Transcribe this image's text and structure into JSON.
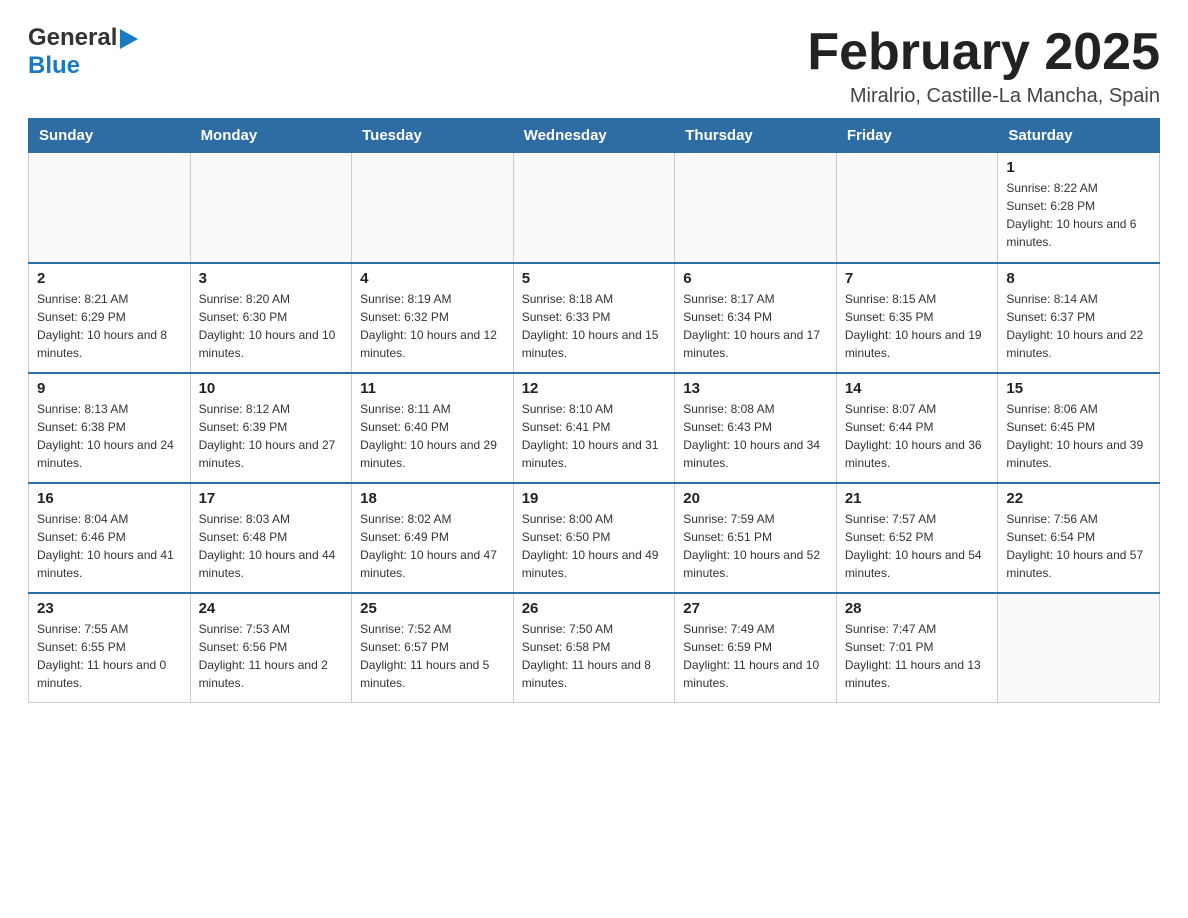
{
  "logo": {
    "general": "General",
    "blue": "Blue"
  },
  "title": "February 2025",
  "subtitle": "Miralrio, Castille-La Mancha, Spain",
  "weekdays": [
    "Sunday",
    "Monday",
    "Tuesday",
    "Wednesday",
    "Thursday",
    "Friday",
    "Saturday"
  ],
  "weeks": [
    [
      {
        "day": "",
        "info": ""
      },
      {
        "day": "",
        "info": ""
      },
      {
        "day": "",
        "info": ""
      },
      {
        "day": "",
        "info": ""
      },
      {
        "day": "",
        "info": ""
      },
      {
        "day": "",
        "info": ""
      },
      {
        "day": "1",
        "info": "Sunrise: 8:22 AM\nSunset: 6:28 PM\nDaylight: 10 hours and 6 minutes."
      }
    ],
    [
      {
        "day": "2",
        "info": "Sunrise: 8:21 AM\nSunset: 6:29 PM\nDaylight: 10 hours and 8 minutes."
      },
      {
        "day": "3",
        "info": "Sunrise: 8:20 AM\nSunset: 6:30 PM\nDaylight: 10 hours and 10 minutes."
      },
      {
        "day": "4",
        "info": "Sunrise: 8:19 AM\nSunset: 6:32 PM\nDaylight: 10 hours and 12 minutes."
      },
      {
        "day": "5",
        "info": "Sunrise: 8:18 AM\nSunset: 6:33 PM\nDaylight: 10 hours and 15 minutes."
      },
      {
        "day": "6",
        "info": "Sunrise: 8:17 AM\nSunset: 6:34 PM\nDaylight: 10 hours and 17 minutes."
      },
      {
        "day": "7",
        "info": "Sunrise: 8:15 AM\nSunset: 6:35 PM\nDaylight: 10 hours and 19 minutes."
      },
      {
        "day": "8",
        "info": "Sunrise: 8:14 AM\nSunset: 6:37 PM\nDaylight: 10 hours and 22 minutes."
      }
    ],
    [
      {
        "day": "9",
        "info": "Sunrise: 8:13 AM\nSunset: 6:38 PM\nDaylight: 10 hours and 24 minutes."
      },
      {
        "day": "10",
        "info": "Sunrise: 8:12 AM\nSunset: 6:39 PM\nDaylight: 10 hours and 27 minutes."
      },
      {
        "day": "11",
        "info": "Sunrise: 8:11 AM\nSunset: 6:40 PM\nDaylight: 10 hours and 29 minutes."
      },
      {
        "day": "12",
        "info": "Sunrise: 8:10 AM\nSunset: 6:41 PM\nDaylight: 10 hours and 31 minutes."
      },
      {
        "day": "13",
        "info": "Sunrise: 8:08 AM\nSunset: 6:43 PM\nDaylight: 10 hours and 34 minutes."
      },
      {
        "day": "14",
        "info": "Sunrise: 8:07 AM\nSunset: 6:44 PM\nDaylight: 10 hours and 36 minutes."
      },
      {
        "day": "15",
        "info": "Sunrise: 8:06 AM\nSunset: 6:45 PM\nDaylight: 10 hours and 39 minutes."
      }
    ],
    [
      {
        "day": "16",
        "info": "Sunrise: 8:04 AM\nSunset: 6:46 PM\nDaylight: 10 hours and 41 minutes."
      },
      {
        "day": "17",
        "info": "Sunrise: 8:03 AM\nSunset: 6:48 PM\nDaylight: 10 hours and 44 minutes."
      },
      {
        "day": "18",
        "info": "Sunrise: 8:02 AM\nSunset: 6:49 PM\nDaylight: 10 hours and 47 minutes."
      },
      {
        "day": "19",
        "info": "Sunrise: 8:00 AM\nSunset: 6:50 PM\nDaylight: 10 hours and 49 minutes."
      },
      {
        "day": "20",
        "info": "Sunrise: 7:59 AM\nSunset: 6:51 PM\nDaylight: 10 hours and 52 minutes."
      },
      {
        "day": "21",
        "info": "Sunrise: 7:57 AM\nSunset: 6:52 PM\nDaylight: 10 hours and 54 minutes."
      },
      {
        "day": "22",
        "info": "Sunrise: 7:56 AM\nSunset: 6:54 PM\nDaylight: 10 hours and 57 minutes."
      }
    ],
    [
      {
        "day": "23",
        "info": "Sunrise: 7:55 AM\nSunset: 6:55 PM\nDaylight: 11 hours and 0 minutes."
      },
      {
        "day": "24",
        "info": "Sunrise: 7:53 AM\nSunset: 6:56 PM\nDaylight: 11 hours and 2 minutes."
      },
      {
        "day": "25",
        "info": "Sunrise: 7:52 AM\nSunset: 6:57 PM\nDaylight: 11 hours and 5 minutes."
      },
      {
        "day": "26",
        "info": "Sunrise: 7:50 AM\nSunset: 6:58 PM\nDaylight: 11 hours and 8 minutes."
      },
      {
        "day": "27",
        "info": "Sunrise: 7:49 AM\nSunset: 6:59 PM\nDaylight: 11 hours and 10 minutes."
      },
      {
        "day": "28",
        "info": "Sunrise: 7:47 AM\nSunset: 7:01 PM\nDaylight: 11 hours and 13 minutes."
      },
      {
        "day": "",
        "info": ""
      }
    ]
  ]
}
